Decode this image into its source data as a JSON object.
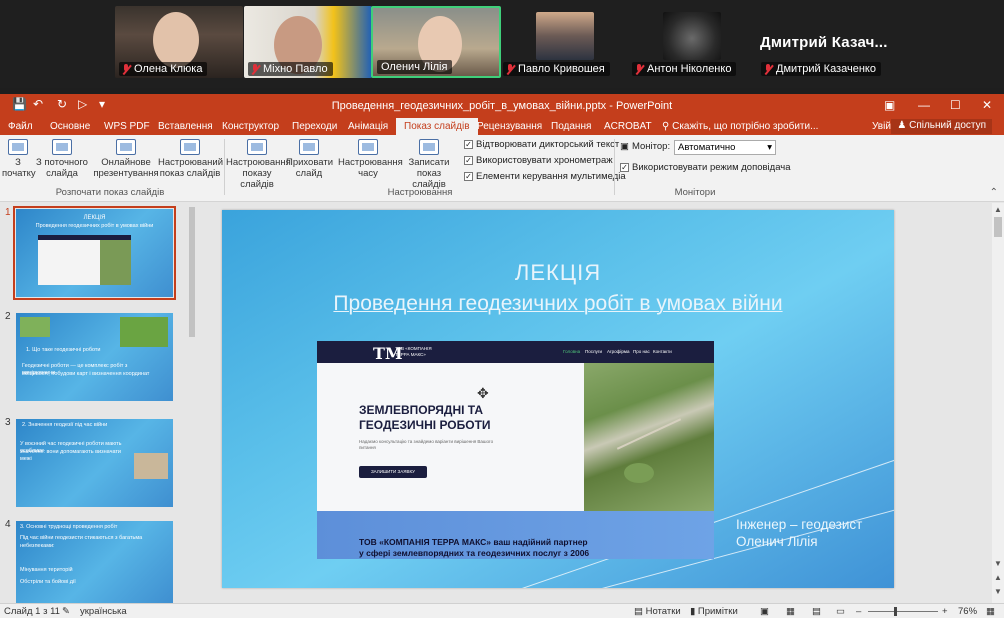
{
  "meeting": {
    "participants": [
      {
        "name": "Олена Клюка",
        "muted": true
      },
      {
        "name": "Міхно Павло",
        "muted": true
      },
      {
        "name": "Оленич Лілія",
        "muted": false
      },
      {
        "name": "Павло Кривошея",
        "muted": true
      },
      {
        "name": "Антон Ніколенко",
        "muted": true
      },
      {
        "name": "Дмитрий Казаченко",
        "muted": true
      }
    ],
    "big_name": "Дмитрий  Казач...",
    "active_speaker_color": "#3fcf7a"
  },
  "window": {
    "title": "Проведення_геодезичних_робіт_в_умовах_війни.pptx - PowerPoint",
    "accent": "#c43e1c"
  },
  "tabs": [
    "Файл",
    "Основне",
    "WPS PDF",
    "Вставлення",
    "Конструктор",
    "Переходи",
    "Анімація",
    "Показ слайдів",
    "Рецензування",
    "Подання",
    "ACROBAT"
  ],
  "tell_me": "Скажіть, що потрібно зробити...",
  "sign_in": "Увійти",
  "share": "Спільний доступ",
  "ribbon": {
    "from_start": [
      "З",
      "початку"
    ],
    "from_current": [
      "З поточного",
      "слайда"
    ],
    "online": [
      "Онлайнове",
      "презентування"
    ],
    "custom_show": [
      "Настроюваний",
      "показ слайдів"
    ],
    "group_start": "Розпочати показ слайдів",
    "setup": [
      "Настроювання",
      "показу слайдів"
    ],
    "hide": [
      "Приховати",
      "слайд"
    ],
    "rehearse": [
      "Настроювання",
      "часу"
    ],
    "record": [
      "Записати показ",
      "слайдів"
    ],
    "chk_narrations": "Відтворювати дикторський текст",
    "chk_timings": "Використовувати хронометраж",
    "chk_media": "Елементи керування мультимедіа",
    "group_setup": "Настроювання",
    "monitor_label": "Монітор:",
    "monitor_value": "Автоматично",
    "presenter_view": "Використовувати режим доповідача",
    "group_monitors": "Монітори"
  },
  "thumbnails": [
    {
      "num": "1",
      "lines": [
        "ЛЕКЦІЯ",
        "Проведення геодезичних робіт в умовах війни"
      ]
    },
    {
      "num": "2",
      "lines": [
        "1. Що таке геодезичні роботи",
        "Геодезичні роботи — це комплекс робіт з вимірювання",
        "місцевості, побудови карт і визначення координат"
      ]
    },
    {
      "num": "3",
      "lines": [
        "2. Значення геодезії під час війни",
        "У воєнний час геодезичні роботи мають особливе",
        "значення: вони допомагають визначати межі"
      ]
    },
    {
      "num": "4",
      "lines": [
        "3. Основні труднощі проведення робіт",
        "Під час війни геодезисти стикаються з багатьма",
        "небезпеками:",
        "Мінування територій",
        "Обстріли та бойові дії"
      ]
    }
  ],
  "slide": {
    "title": "ЛЕКЦІЯ",
    "subtitle": "Проведення геодезичних робіт в умовах війни",
    "author_line1": "Інженер – геодезист",
    "author_line2": "Оленич Лілія",
    "website": {
      "logo": "ТМ",
      "logo_text": [
        "ТОВ «КОМПАНІЯ",
        "ТЕРРА МАКС»"
      ],
      "nav": [
        "Головна",
        "Послуги",
        "Агрофірма",
        "Про нас",
        "Контакти"
      ],
      "heading": [
        "ЗЕМЛЕВПОРЯДНІ ТА",
        "ГЕОДЕЗИЧНІ РОБОТИ"
      ],
      "paragraph": "Надаємо консультацію та знайдемо варіанти вирішення Вашого питання",
      "button": "ЗАЛИШИТИ ЗАЯВКУ",
      "bottom": [
        "ТОВ «КОМПАНІЯ ТЕРРА МАКС» ваш надійний партнер",
        "у сфері землевпорядних та геодезичних послуг з 2006"
      ]
    }
  },
  "status": {
    "slide_info": "Слайд 1 з 11",
    "language": "українська",
    "notes": "Нотатки",
    "comments": "Примітки",
    "zoom": "76%"
  }
}
